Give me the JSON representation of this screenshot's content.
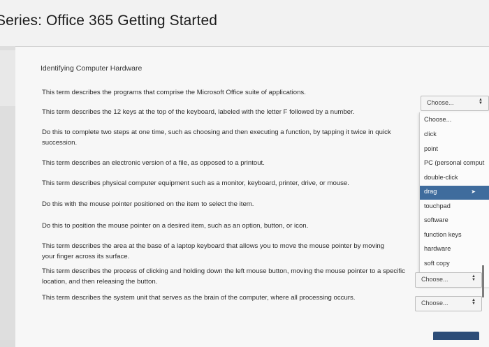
{
  "page": {
    "title": "Series: Office 365 Getting Started"
  },
  "section": {
    "title": "Identifying Computer Hardware"
  },
  "questions": [
    "This term describes the programs that comprise the Microsoft Office suite of applications.",
    "This term describes the 12 keys at the top of the keyboard, labeled with the letter F followed by a number.",
    "Do this to complete two steps at one time, such as choosing and then executing a function, by tapping it twice in quick succession.",
    "This term describes an electronic version of a file, as opposed to a printout.",
    "This term describes physical computer equipment such as a monitor, keyboard, printer, drive, or mouse.",
    "Do this with the mouse pointer positioned on the item to select the item.",
    "Do this to position the mouse pointer on a desired item, such as an option, button, or icon.",
    "This term describes the area at the base of a laptop keyboard that allows you to move the mouse pointer by moving your finger across its surface.",
    "This term describes the process of clicking and holding down the left mouse button, moving the mouse pointer to a specific location, and then releasing the button.",
    "This term describes the system unit that serves as the brain of the computer, where all processing occurs."
  ],
  "dropdowns": {
    "first": "Choose...",
    "ninth": "Choose...",
    "tenth": "Choose..."
  },
  "open_list": {
    "options": [
      "Choose...",
      "click",
      "point",
      "PC (personal comput",
      "double-click",
      "drag",
      "touchpad",
      "software",
      "function keys",
      "hardware",
      "soft copy"
    ],
    "selected": "drag"
  },
  "colors": {
    "selected_bg": "#3f6c9d",
    "panel_bg": "#f7f7f7"
  }
}
